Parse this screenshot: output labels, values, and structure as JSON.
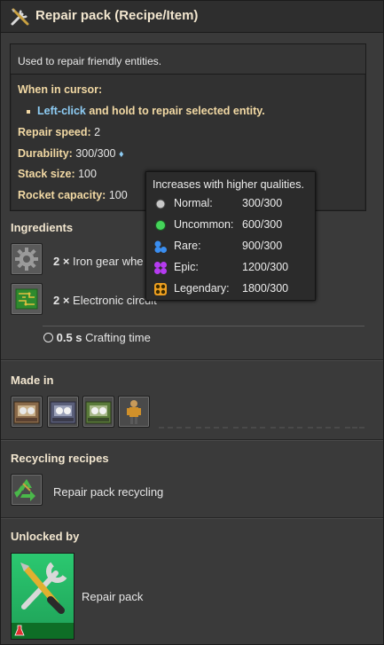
{
  "title": "Repair pack (Recipe/Item)",
  "description": "Used to repair friendly entities.",
  "cursor": {
    "heading": "When in cursor:",
    "action_key": "Left-click",
    "action_text": " and hold to repair selected entity."
  },
  "props": {
    "repair_speed_label": "Repair speed:",
    "repair_speed_value": " 2",
    "durability_label": "Durability:",
    "durability_value": " 300/300",
    "stack_label": "Stack size:",
    "stack_value": " 100",
    "rocket_label": "Rocket capacity:",
    "rocket_value": " 100"
  },
  "ingredients": {
    "title": "Ingredients",
    "items": [
      {
        "count": "2 ×",
        "name": " Iron gear whe"
      },
      {
        "count": "2 ×",
        "name": " Electronic circuit"
      }
    ],
    "time_value": "0.5 s",
    "time_label": " Crafting time"
  },
  "made_in": {
    "title": "Made in"
  },
  "recycling": {
    "title": "Recycling recipes",
    "item": "Repair pack recycling"
  },
  "unlocked": {
    "title": "Unlocked by",
    "item": "Repair pack"
  },
  "tooltip": {
    "heading": "Increases with higher qualities.",
    "rows": [
      {
        "name": "Normal:",
        "value": "300/300",
        "color": "#c8c8c8"
      },
      {
        "name": "Uncommon:",
        "value": "600/300",
        "color": "#45d45a"
      },
      {
        "name": "Rare:",
        "value": "900/300",
        "color": "#3a8ef0"
      },
      {
        "name": "Epic:",
        "value": "1200/300",
        "color": "#b53bf0"
      },
      {
        "name": "Legendary:",
        "value": "1800/300",
        "color": "#f0a020"
      }
    ]
  }
}
